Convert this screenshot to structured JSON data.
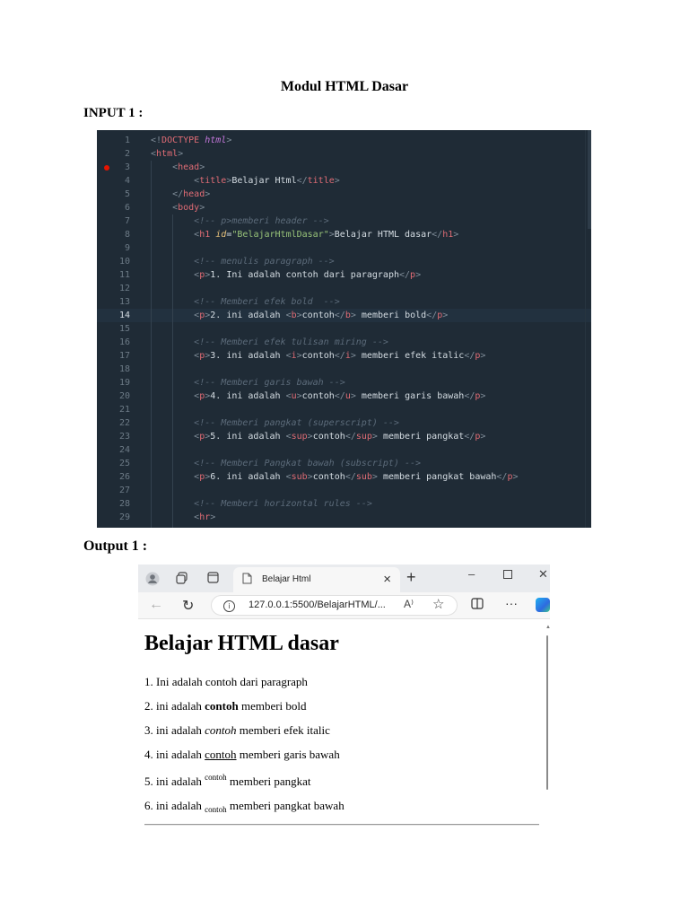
{
  "document": {
    "title": "Modul HTML Dasar",
    "input_label": "INPUT 1 :",
    "output_label": "Output 1 :"
  },
  "editor": {
    "colors": {
      "background": "#1f2b36",
      "tag": "#e06c75",
      "attribute": "#e5c07b",
      "string": "#98c379",
      "comment": "#5c6b7a",
      "breakpoint": "#e51400"
    },
    "breakpoint_line": 3,
    "active_line": 14,
    "lines": [
      {
        "n": "1",
        "t": [
          {
            "c": "pu",
            "s": "<!"
          },
          {
            "c": "tn",
            "s": "DOCTYPE"
          },
          {
            "c": "pu",
            "s": " "
          },
          {
            "c": "kw",
            "s": "html"
          },
          {
            "c": "pu",
            "s": ">"
          }
        ]
      },
      {
        "n": "2",
        "t": [
          {
            "c": "pu",
            "s": "<"
          },
          {
            "c": "tn",
            "s": "html"
          },
          {
            "c": "pu",
            "s": ">"
          }
        ]
      },
      {
        "n": "3",
        "t": [
          {
            "c": "",
            "s": "    "
          },
          {
            "c": "pu",
            "s": "<"
          },
          {
            "c": "tn",
            "s": "head"
          },
          {
            "c": "pu",
            "s": ">"
          }
        ]
      },
      {
        "n": "4",
        "t": [
          {
            "c": "",
            "s": "        "
          },
          {
            "c": "pu",
            "s": "<"
          },
          {
            "c": "tn",
            "s": "title"
          },
          {
            "c": "pu",
            "s": ">"
          },
          {
            "c": "",
            "s": "Belajar Html"
          },
          {
            "c": "pu",
            "s": "</"
          },
          {
            "c": "tn",
            "s": "title"
          },
          {
            "c": "pu",
            "s": ">"
          }
        ]
      },
      {
        "n": "5",
        "t": [
          {
            "c": "",
            "s": "    "
          },
          {
            "c": "pu",
            "s": "</"
          },
          {
            "c": "tn",
            "s": "head"
          },
          {
            "c": "pu",
            "s": ">"
          }
        ]
      },
      {
        "n": "6",
        "t": [
          {
            "c": "",
            "s": "    "
          },
          {
            "c": "pu",
            "s": "<"
          },
          {
            "c": "tn",
            "s": "body"
          },
          {
            "c": "pu",
            "s": ">"
          }
        ]
      },
      {
        "n": "7",
        "t": [
          {
            "c": "",
            "s": "        "
          },
          {
            "c": "cm",
            "s": "<!-- p>memberi header -->"
          }
        ]
      },
      {
        "n": "8",
        "t": [
          {
            "c": "",
            "s": "        "
          },
          {
            "c": "pu",
            "s": "<"
          },
          {
            "c": "tn",
            "s": "h1"
          },
          {
            "c": "",
            "s": " "
          },
          {
            "c": "at",
            "s": "id"
          },
          {
            "c": "",
            "s": "="
          },
          {
            "c": "st",
            "s": "\"BelajarHtmlDasar\""
          },
          {
            "c": "pu",
            "s": ">"
          },
          {
            "c": "",
            "s": "Belajar HTML dasar"
          },
          {
            "c": "pu",
            "s": "</"
          },
          {
            "c": "tn",
            "s": "h1"
          },
          {
            "c": "pu",
            "s": ">"
          }
        ]
      },
      {
        "n": "9",
        "t": []
      },
      {
        "n": "10",
        "t": [
          {
            "c": "",
            "s": "        "
          },
          {
            "c": "cm",
            "s": "<!-- menulis paragraph -->"
          }
        ]
      },
      {
        "n": "11",
        "t": [
          {
            "c": "",
            "s": "        "
          },
          {
            "c": "pu",
            "s": "<"
          },
          {
            "c": "tn",
            "s": "p"
          },
          {
            "c": "pu",
            "s": ">"
          },
          {
            "c": "",
            "s": "1. Ini adalah contoh dari paragraph"
          },
          {
            "c": "pu",
            "s": "</"
          },
          {
            "c": "tn",
            "s": "p"
          },
          {
            "c": "pu",
            "s": ">"
          }
        ]
      },
      {
        "n": "12",
        "t": []
      },
      {
        "n": "13",
        "t": [
          {
            "c": "",
            "s": "        "
          },
          {
            "c": "cm",
            "s": "<!-- Memberi efek bold  -->"
          }
        ]
      },
      {
        "n": "14",
        "t": [
          {
            "c": "",
            "s": "        "
          },
          {
            "c": "pu",
            "s": "<"
          },
          {
            "c": "tn",
            "s": "p"
          },
          {
            "c": "pu",
            "s": ">"
          },
          {
            "c": "",
            "s": "2. ini adalah "
          },
          {
            "c": "pu",
            "s": "<"
          },
          {
            "c": "tn",
            "s": "b"
          },
          {
            "c": "pu",
            "s": ">"
          },
          {
            "c": "",
            "s": "contoh"
          },
          {
            "c": "pu",
            "s": "</"
          },
          {
            "c": "tn",
            "s": "b"
          },
          {
            "c": "pu",
            "s": ">"
          },
          {
            "c": "",
            "s": " memberi bold"
          },
          {
            "c": "pu",
            "s": "</"
          },
          {
            "c": "tn",
            "s": "p"
          },
          {
            "c": "pu",
            "s": ">"
          }
        ]
      },
      {
        "n": "15",
        "t": []
      },
      {
        "n": "16",
        "t": [
          {
            "c": "",
            "s": "        "
          },
          {
            "c": "cm",
            "s": "<!-- Memberi efek tulisan miring -->"
          }
        ]
      },
      {
        "n": "17",
        "t": [
          {
            "c": "",
            "s": "        "
          },
          {
            "c": "pu",
            "s": "<"
          },
          {
            "c": "tn",
            "s": "p"
          },
          {
            "c": "pu",
            "s": ">"
          },
          {
            "c": "",
            "s": "3. ini adalah "
          },
          {
            "c": "pu",
            "s": "<"
          },
          {
            "c": "tn",
            "s": "i"
          },
          {
            "c": "pu",
            "s": ">"
          },
          {
            "c": "",
            "s": "contoh"
          },
          {
            "c": "pu",
            "s": "</"
          },
          {
            "c": "tn",
            "s": "i"
          },
          {
            "c": "pu",
            "s": ">"
          },
          {
            "c": "",
            "s": " memberi efek italic"
          },
          {
            "c": "pu",
            "s": "</"
          },
          {
            "c": "tn",
            "s": "p"
          },
          {
            "c": "pu",
            "s": ">"
          }
        ]
      },
      {
        "n": "18",
        "t": []
      },
      {
        "n": "19",
        "t": [
          {
            "c": "",
            "s": "        "
          },
          {
            "c": "cm",
            "s": "<!-- Memberi garis bawah -->"
          }
        ]
      },
      {
        "n": "20",
        "t": [
          {
            "c": "",
            "s": "        "
          },
          {
            "c": "pu",
            "s": "<"
          },
          {
            "c": "tn",
            "s": "p"
          },
          {
            "c": "pu",
            "s": ">"
          },
          {
            "c": "",
            "s": "4. ini adalah "
          },
          {
            "c": "pu",
            "s": "<"
          },
          {
            "c": "tn",
            "s": "u"
          },
          {
            "c": "pu",
            "s": ">"
          },
          {
            "c": "",
            "s": "contoh"
          },
          {
            "c": "pu",
            "s": "</"
          },
          {
            "c": "tn",
            "s": "u"
          },
          {
            "c": "pu",
            "s": ">"
          },
          {
            "c": "",
            "s": " memberi garis bawah"
          },
          {
            "c": "pu",
            "s": "</"
          },
          {
            "c": "tn",
            "s": "p"
          },
          {
            "c": "pu",
            "s": ">"
          }
        ]
      },
      {
        "n": "21",
        "t": []
      },
      {
        "n": "22",
        "t": [
          {
            "c": "",
            "s": "        "
          },
          {
            "c": "cm",
            "s": "<!-- Memberi pangkat (superscript) -->"
          }
        ]
      },
      {
        "n": "23",
        "t": [
          {
            "c": "",
            "s": "        "
          },
          {
            "c": "pu",
            "s": "<"
          },
          {
            "c": "tn",
            "s": "p"
          },
          {
            "c": "pu",
            "s": ">"
          },
          {
            "c": "",
            "s": "5. ini adalah "
          },
          {
            "c": "pu",
            "s": "<"
          },
          {
            "c": "tn",
            "s": "sup"
          },
          {
            "c": "pu",
            "s": ">"
          },
          {
            "c": "",
            "s": "contoh"
          },
          {
            "c": "pu",
            "s": "</"
          },
          {
            "c": "tn",
            "s": "sup"
          },
          {
            "c": "pu",
            "s": ">"
          },
          {
            "c": "",
            "s": " memberi pangkat"
          },
          {
            "c": "pu",
            "s": "</"
          },
          {
            "c": "tn",
            "s": "p"
          },
          {
            "c": "pu",
            "s": ">"
          }
        ]
      },
      {
        "n": "24",
        "t": []
      },
      {
        "n": "25",
        "t": [
          {
            "c": "",
            "s": "        "
          },
          {
            "c": "cm",
            "s": "<!-- Memberi Pangkat bawah (subscript) -->"
          }
        ]
      },
      {
        "n": "26",
        "t": [
          {
            "c": "",
            "s": "        "
          },
          {
            "c": "pu",
            "s": "<"
          },
          {
            "c": "tn",
            "s": "p"
          },
          {
            "c": "pu",
            "s": ">"
          },
          {
            "c": "",
            "s": "6. ini adalah "
          },
          {
            "c": "pu",
            "s": "<"
          },
          {
            "c": "tn",
            "s": "sub"
          },
          {
            "c": "pu",
            "s": ">"
          },
          {
            "c": "",
            "s": "contoh"
          },
          {
            "c": "pu",
            "s": "</"
          },
          {
            "c": "tn",
            "s": "sub"
          },
          {
            "c": "pu",
            "s": ">"
          },
          {
            "c": "",
            "s": " memberi pangkat bawah"
          },
          {
            "c": "pu",
            "s": "</"
          },
          {
            "c": "tn",
            "s": "p"
          },
          {
            "c": "pu",
            "s": ">"
          }
        ]
      },
      {
        "n": "27",
        "t": []
      },
      {
        "n": "28",
        "t": [
          {
            "c": "",
            "s": "        "
          },
          {
            "c": "cm",
            "s": "<!-- Memberi horizontal rules -->"
          }
        ]
      },
      {
        "n": "29",
        "t": [
          {
            "c": "",
            "s": "        "
          },
          {
            "c": "pu",
            "s": "<"
          },
          {
            "c": "tn",
            "s": "hr"
          },
          {
            "c": "pu",
            "s": ">"
          }
        ]
      }
    ]
  },
  "browser": {
    "tab_title": "Belajar Html",
    "url": "127.0.0.1:5500/BelajarHTML/...",
    "read_aloud_label": "A⁾",
    "icons": [
      "profile-icon",
      "workspaces-icon",
      "tab-actions-icon",
      "page-icon",
      "close-icon",
      "new-tab-icon",
      "minimize-icon",
      "maximize-icon",
      "window-close-icon",
      "back-icon",
      "refresh-icon",
      "info-icon",
      "read-aloud-icon",
      "favorite-icon",
      "split-screen-icon",
      "more-icon",
      "copilot-icon"
    ],
    "page": {
      "heading": "Belajar HTML dasar",
      "lines": [
        {
          "prefix": "1. Ini adalah contoh dari paragraph"
        },
        {
          "prefix": "2. ini adalah ",
          "word": "contoh",
          "suffix": " memberi bold"
        },
        {
          "prefix": "3. ini adalah ",
          "word": "contoh",
          "suffix": " memberi efek italic"
        },
        {
          "prefix": "4. ini adalah ",
          "word": "contoh",
          "suffix": " memberi garis bawah"
        },
        {
          "prefix": "5. ini adalah ",
          "word": "contoh",
          "suffix": " memberi pangkat"
        },
        {
          "prefix": "6. ini adalah ",
          "word": "contoh",
          "suffix": " memberi pangkat bawah"
        }
      ]
    }
  }
}
